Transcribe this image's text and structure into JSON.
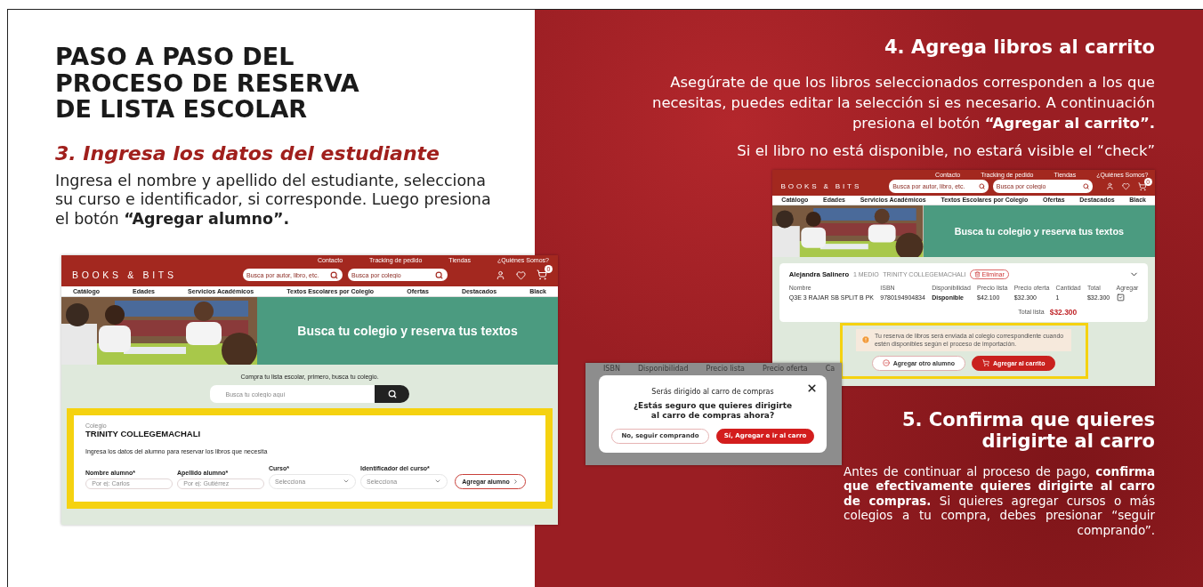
{
  "slide": {
    "title_lines": [
      "PASO A PASO DEL",
      "PROCESO DE RESERVA",
      "DE LISTA ESCOLAR"
    ]
  },
  "step3": {
    "title": "3. Ingresa los datos del estudiante",
    "text": "Ingresa el nombre y apellido del estudiante, selecciona su curso e identificador, si corresponde. Luego presiona el botón **“Agregar alumno”.**"
  },
  "screen1": {
    "header": {
      "top_links": [
        "Contacto",
        "Tracking de pedido",
        "Tiendas",
        "¿Quiénes Somos?"
      ],
      "logo": "BOOKS & BITS",
      "search_placeholders": [
        "Busca por autor, libro, etc.",
        "Busca por colegio"
      ],
      "cart_count": "0",
      "nav": [
        "Catálogo",
        "Edades",
        "Servicios Académicos",
        "Textos Escolares por Colegio",
        "Ofertas",
        "Destacados",
        "Black"
      ],
      "hero": "Busca tu colegio y reserva tus textos"
    },
    "intro": "Compra tu lista escolar, primero, busca tu colegio.",
    "school_search": {
      "placeholder": "Busca tu colegio aquí"
    },
    "form": {
      "school_label": "Colegio",
      "school": "TRINITY COLLEGEMACHALI",
      "instructions": "Ingresa los datos del alumno para reservar los libros que necesita",
      "fields": [
        {
          "kind": "input",
          "label": "Nombre alumno*",
          "placeholder": "Por ej: Carlos"
        },
        {
          "kind": "input",
          "label": "Apellido alumno*",
          "placeholder": "Por ej: Gutiérrez"
        },
        {
          "kind": "select",
          "label": "Curso*",
          "value": "Selecciona"
        },
        {
          "kind": "select",
          "label": "Identificador del curso*",
          "value": "Selecciona"
        }
      ],
      "button": "Agregar alumno"
    }
  },
  "step4": {
    "title": "4. Agrega libros al carrito",
    "text": "Asegúrate de que los libros seleccionados corresponden a los que necesitas, puedes editar la selección si es necesario. A continuación presiona el botón **“Agregar al carrito”.**",
    "note": "Si el libro no está disponible, no estará visible el “check”"
  },
  "screen2": {
    "header": {
      "top_links": [
        "Contacto",
        "Tracking de pedido",
        "Tiendas",
        "¿Quiénes Somos?"
      ],
      "logo": "BOOKS & BITS",
      "search_placeholders": [
        "Busca por autor, libro, etc.",
        "Busca por colegio"
      ],
      "cart_count": "0",
      "nav": [
        "Catálogo",
        "Edades",
        "Servicios Académicos",
        "Textos Escolares por Colegio",
        "Ofertas",
        "Destacados",
        "Black"
      ],
      "hero": "Busca tu colegio y reserva tus textos"
    },
    "student": {
      "name": "Alejandra Salinero",
      "course": "1 MEDIO",
      "school": "TRINITY COLLEGEMACHALI",
      "remove": "Eliminar"
    },
    "columns": [
      "Nombre",
      "ISBN",
      "Disponibilidad",
      "Precio lista",
      "Precio oferta",
      "Cantidad",
      "Total",
      "Agregar"
    ],
    "rows": [
      {
        "cells": [
          "Q3E 3 RAJAR SB SPLIT B PK",
          "9780194904834",
          "Disponible",
          "$42.100",
          "$32.300",
          "1",
          "$32.300"
        ],
        "added": true
      }
    ],
    "total_label": "Total lista",
    "total": "$32.300",
    "notice": "Tu reserva de libros será enviada al colegio correspondiente cuando estén disponibles según el proceso de importación.",
    "buttons": [
      {
        "label": "Agregar otro alumno",
        "kind": "secondary"
      },
      {
        "label": "Agregar al carrito",
        "kind": "primary"
      }
    ]
  },
  "dialog": {
    "background_columns": [
      "ISBN",
      "Disponibilidad",
      "Precio lista",
      "Precio oferta",
      "Ca"
    ],
    "subtitle": "Serás dirigido al carro de compras",
    "question": "¿Estás seguro que quieres dirigirte al carro de compras ahora?",
    "buttons": [
      {
        "label": "No, seguir comprando",
        "kind": "secondary"
      },
      {
        "label": "Sí, Agregar e ir al carro",
        "kind": "primary"
      }
    ]
  },
  "step5": {
    "title": "5. Confirma que quieres dirigirte al carro",
    "text": "Antes de continuar al proceso de pago, **confirma que efectivamente quieres dirigirte al carro de compras.** Si quieres agregar cursos o más colegios a tu compra, debes presionar “seguir comprando”."
  }
}
